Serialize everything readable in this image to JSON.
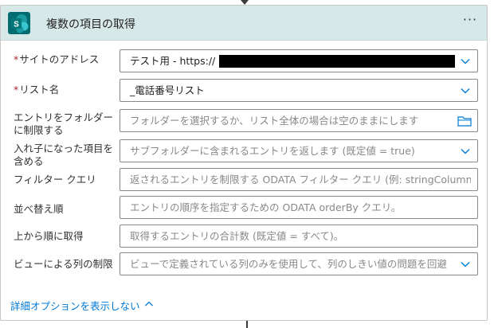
{
  "action": {
    "title": "複数の項目の取得",
    "more_label": "···",
    "brand_color": "#036c70"
  },
  "fields": [
    {
      "label": "サイトのアドレス",
      "required": true,
      "value": "テスト用 - https://",
      "redacted": true
    },
    {
      "label": "リスト名",
      "required": true,
      "value": "_電話番号リスト"
    },
    {
      "label": "エントリをフォルダーに制限する",
      "placeholder": "フォルダーを選択するか、リスト全体の場合は空のままにします"
    },
    {
      "label": "入れ子になった項目を含める",
      "placeholder": "サブフォルダーに含まれるエントリを返します (既定値 = true)"
    },
    {
      "label": "フィルター クエリ",
      "placeholder": "返されるエントリを制限する ODATA フィルター クエリ (例: stringColumn eq '"
    },
    {
      "label": "並べ替え順",
      "placeholder": "エントリの順序を指定するための ODATA orderBy クエリ。"
    },
    {
      "label": "上から順に取得",
      "placeholder": "取得するエントリの合計数 (既定値 = すべて)。"
    },
    {
      "label": "ビューによる列の制限",
      "placeholder": "ビューで定義されている列のみを使用して、列のしきい値の問題を回避"
    }
  ],
  "advanced_link": "詳細オプションを表示しない",
  "colors": {
    "header_bg": "#d7e8e8",
    "accent": "#0078d4",
    "required": "#a4262c"
  }
}
